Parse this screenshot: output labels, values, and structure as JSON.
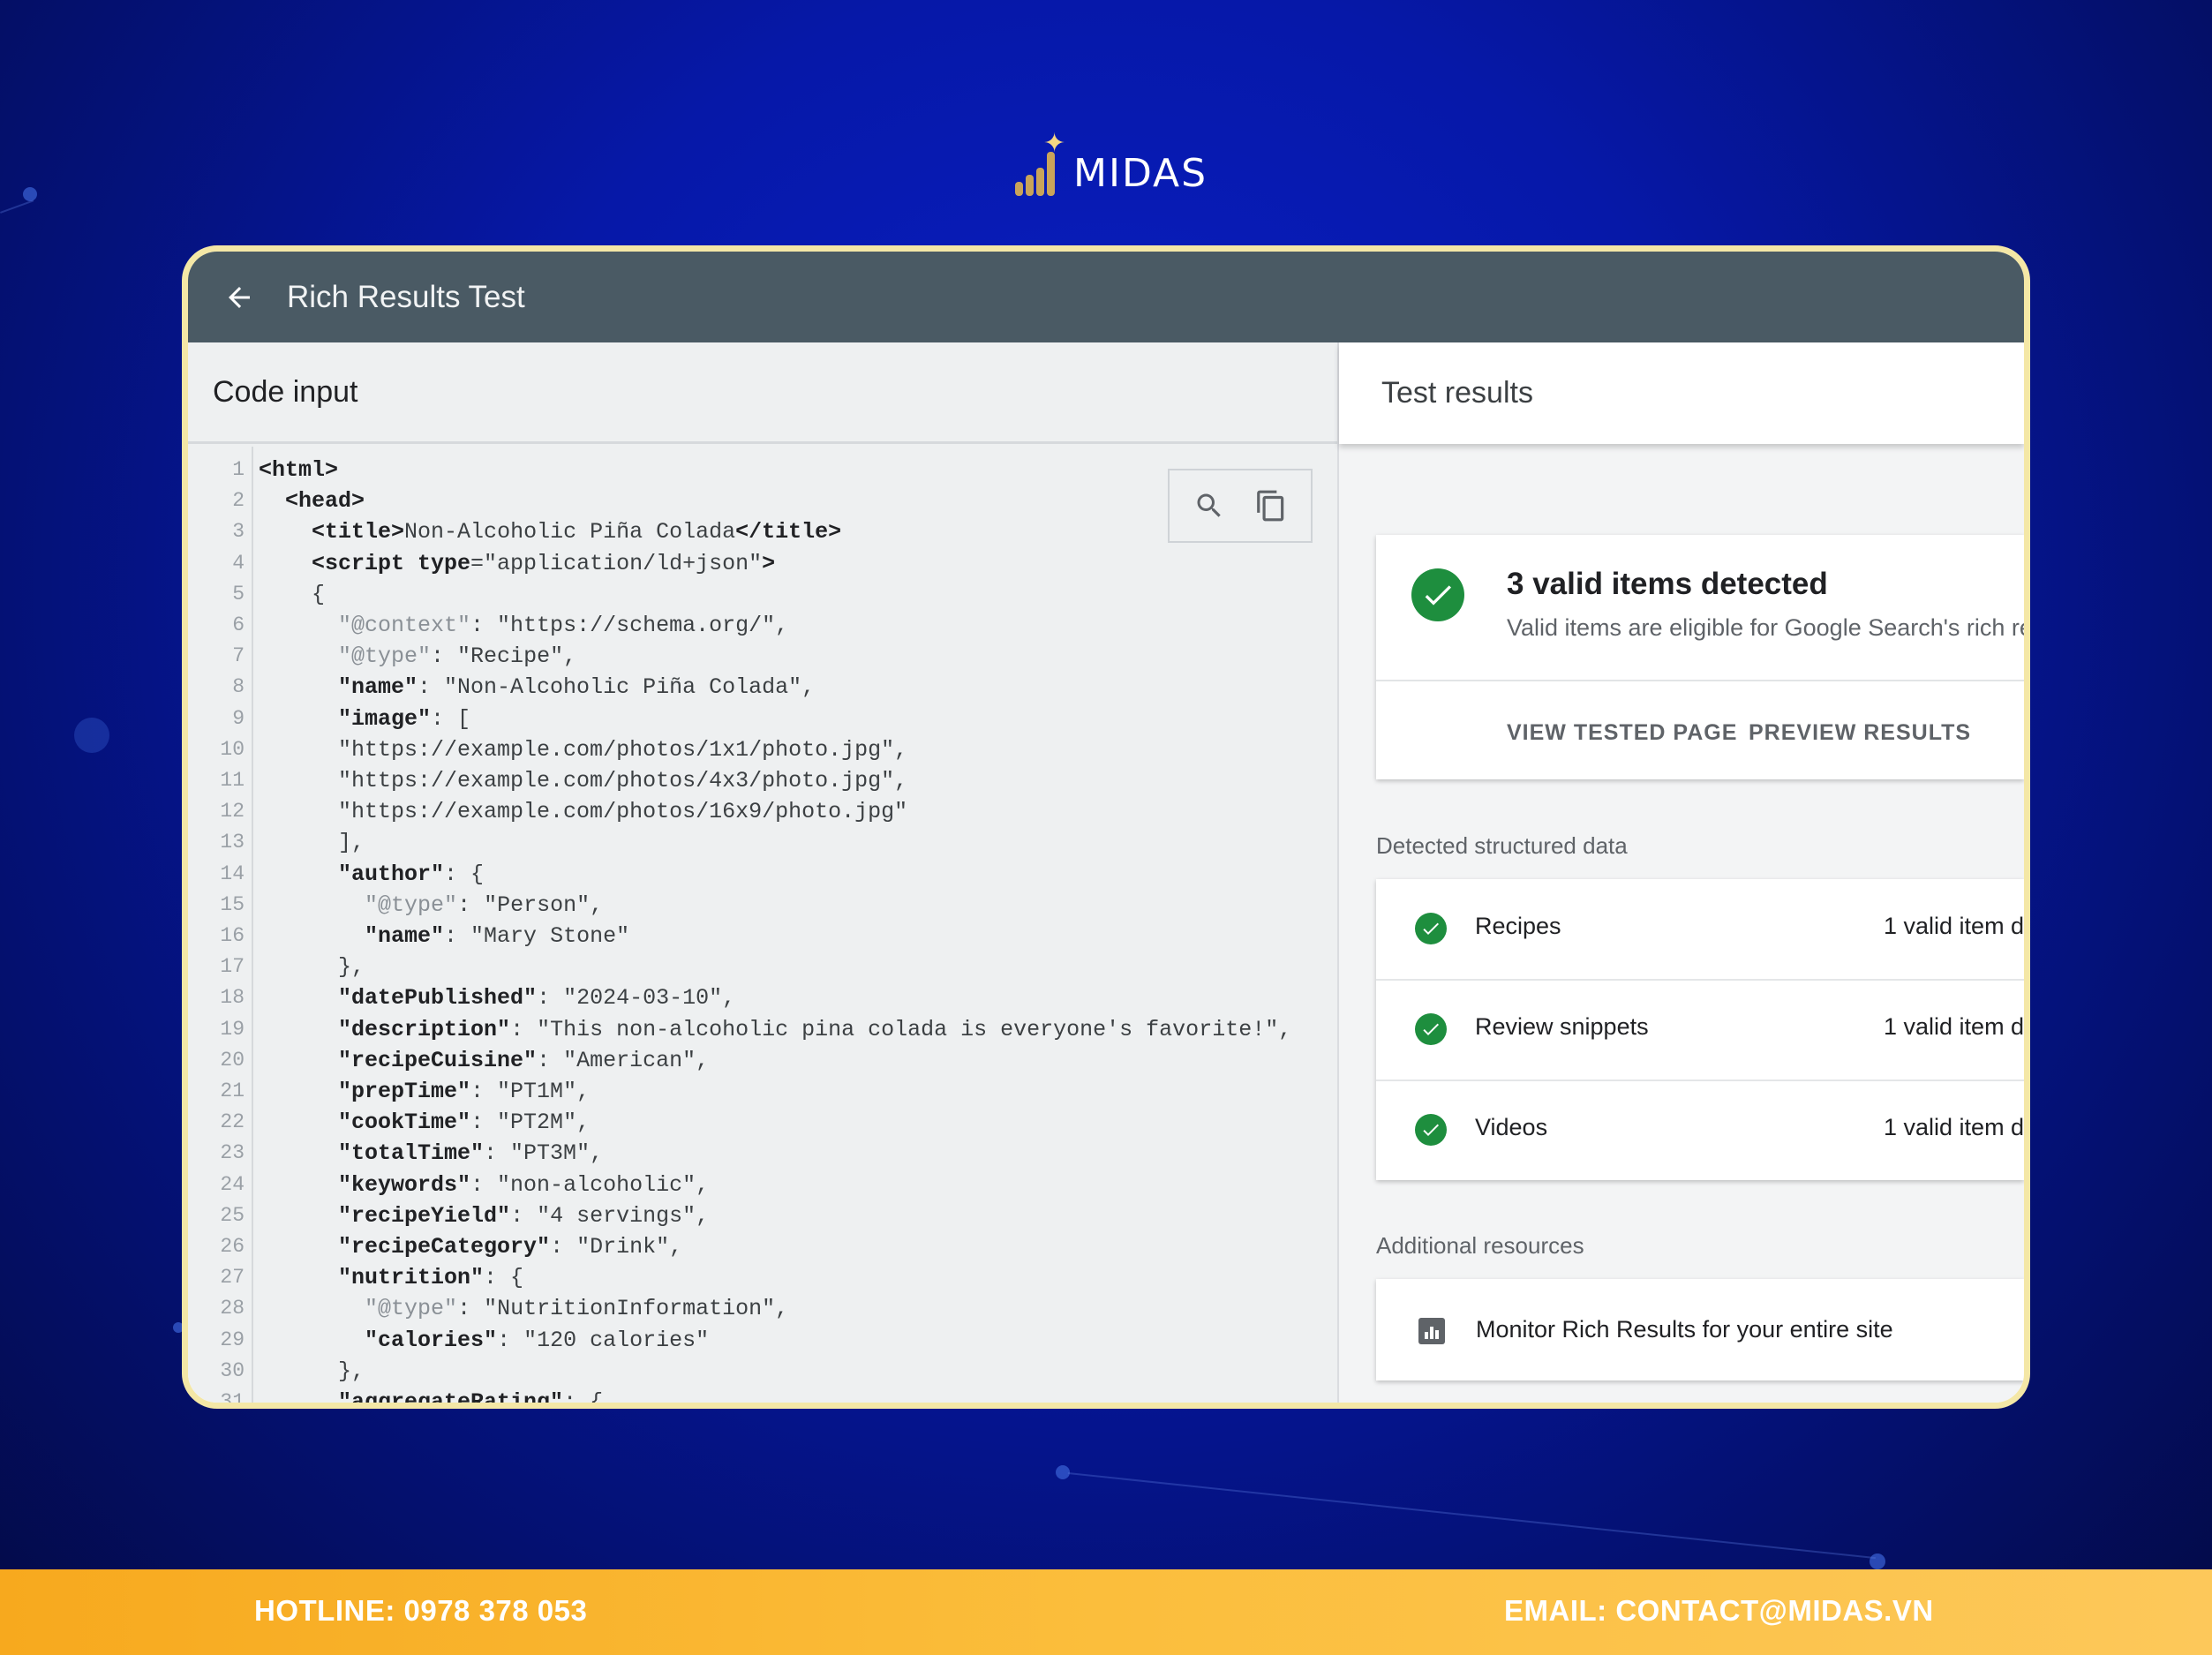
{
  "brand": {
    "logo_text": "MIDAS"
  },
  "window": {
    "title": "Rich Results Test"
  },
  "code_panel": {
    "heading": "Code input",
    "lines": [
      {
        "n": "1",
        "html": "<b>&lt;html&gt;</b>"
      },
      {
        "n": "2",
        "html": "  <b>&lt;head&gt;</b>"
      },
      {
        "n": "3",
        "html": "    <b>&lt;title&gt;</b>Non-Alcoholic Piña Colada<b>&lt;/title&gt;</b>"
      },
      {
        "n": "4",
        "html": "    <b>&lt;script type</b>=\"application/ld+json\"<b>&gt;</b>"
      },
      {
        "n": "5",
        "html": "    {"
      },
      {
        "n": "6",
        "html": "      <span class=\"g\">\"@context\"</span>: \"https://schema.org/\","
      },
      {
        "n": "7",
        "html": "      <span class=\"g\">\"@type\"</span>: \"Recipe\","
      },
      {
        "n": "8",
        "html": "      <b>\"name\"</b>: \"Non-Alcoholic Piña Colada\","
      },
      {
        "n": "9",
        "html": "      <b>\"image\"</b>: ["
      },
      {
        "n": "10",
        "html": "      \"https://example.com/photos/1x1/photo.jpg\","
      },
      {
        "n": "11",
        "html": "      \"https://example.com/photos/4x3/photo.jpg\","
      },
      {
        "n": "12",
        "html": "      \"https://example.com/photos/16x9/photo.jpg\""
      },
      {
        "n": "13",
        "html": "      ],"
      },
      {
        "n": "14",
        "html": "      <b>\"author\"</b>: {"
      },
      {
        "n": "15",
        "html": "        <span class=\"g\">\"@type\"</span>: \"Person\","
      },
      {
        "n": "16",
        "html": "        <b>\"name\"</b>: \"Mary Stone\""
      },
      {
        "n": "17",
        "html": "      },"
      },
      {
        "n": "18",
        "html": "      <b>\"datePublished\"</b>: \"2024-03-10\","
      },
      {
        "n": "19",
        "html": "      <b>\"description\"</b>: \"This non-alcoholic pina colada is everyone's favorite!\","
      },
      {
        "n": "20",
        "html": "      <b>\"recipeCuisine\"</b>: \"American\","
      },
      {
        "n": "21",
        "html": "      <b>\"prepTime\"</b>: \"PT1M\","
      },
      {
        "n": "22",
        "html": "      <b>\"cookTime\"</b>: \"PT2M\","
      },
      {
        "n": "23",
        "html": "      <b>\"totalTime\"</b>: \"PT3M\","
      },
      {
        "n": "24",
        "html": "      <b>\"keywords\"</b>: \"non-alcoholic\","
      },
      {
        "n": "25",
        "html": "      <b>\"recipeYield\"</b>: \"4 servings\","
      },
      {
        "n": "26",
        "html": "      <b>\"recipeCategory\"</b>: \"Drink\","
      },
      {
        "n": "27",
        "html": "      <b>\"nutrition\"</b>: {"
      },
      {
        "n": "28",
        "html": "        <span class=\"g\">\"@type\"</span>: \"NutritionInformation\","
      },
      {
        "n": "29",
        "html": "        <b>\"calories\"</b>: \"120 calories\""
      },
      {
        "n": "30",
        "html": "      },"
      },
      {
        "n": "31",
        "html": "      <b>\"aggregateRating\"</b>: {"
      }
    ]
  },
  "results_panel": {
    "heading": "Test results",
    "summary": {
      "title": "3 valid items detected",
      "subtitle": "Valid items are eligible for Google Search's rich res",
      "buttons": [
        "VIEW TESTED PAGE",
        "PREVIEW RESULTS"
      ]
    },
    "structured_label": "Detected structured data",
    "structured_items": [
      {
        "name": "Recipes",
        "status": "1 valid item d"
      },
      {
        "name": "Review snippets",
        "status": "1 valid item d"
      },
      {
        "name": "Videos",
        "status": "1 valid item d"
      }
    ],
    "resources_label": "Additional resources",
    "resource": "Monitor Rich Results for your entire site"
  },
  "footer": {
    "hotline": "HOTLINE: 0978 378 053",
    "email": "EMAIL: CONTACT@MIDAS.VN"
  },
  "colors": {
    "topbar": "#4a5a64",
    "success": "#1e8e3e",
    "frame_border": "#f4e7a6",
    "footer": "#fbbe3c"
  }
}
